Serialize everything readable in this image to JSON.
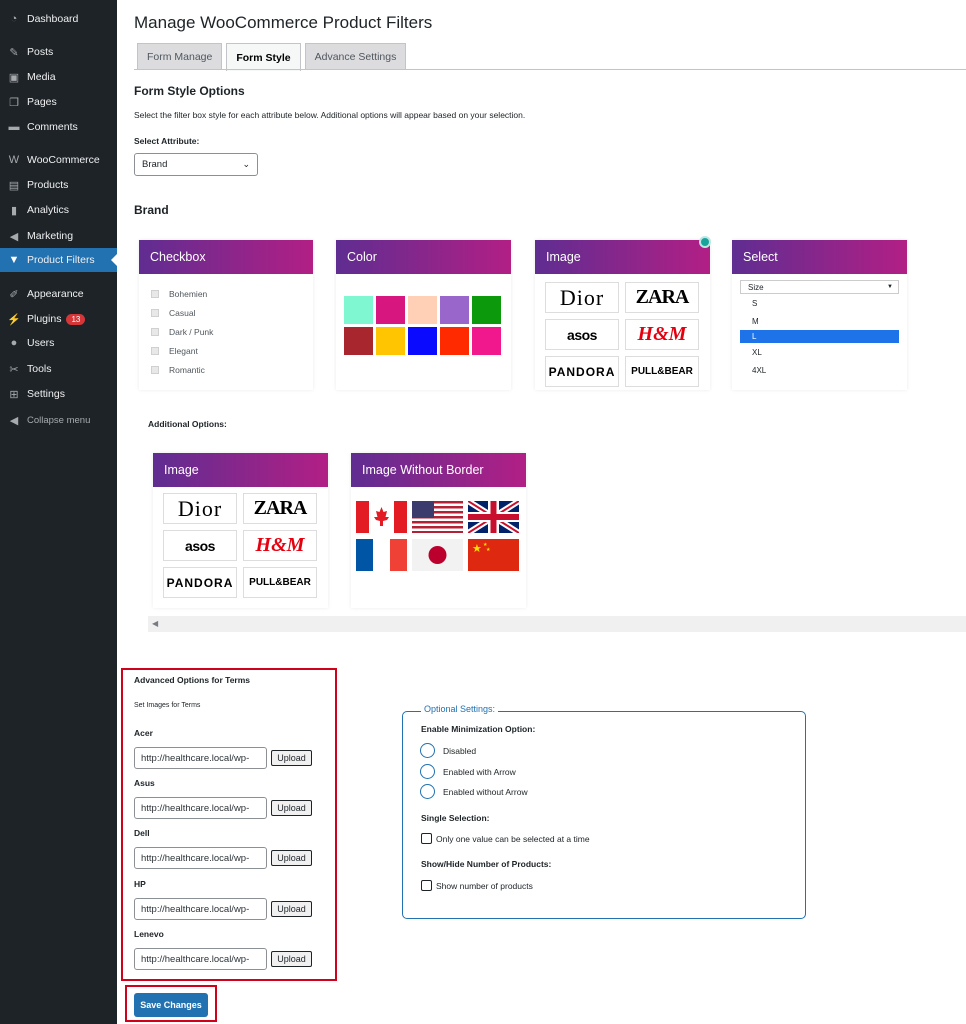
{
  "sidebar": {
    "items": [
      {
        "label": "Dashboard",
        "icon": "dashboard-icon",
        "glyph": "◔"
      },
      {
        "label": "Posts",
        "icon": "pin-icon",
        "glyph": "✎"
      },
      {
        "label": "Media",
        "icon": "media-icon",
        "glyph": "▣"
      },
      {
        "label": "Pages",
        "icon": "pages-icon",
        "glyph": "❐"
      },
      {
        "label": "Comments",
        "icon": "comment-icon",
        "glyph": "▬"
      },
      {
        "label": "WooCommerce",
        "icon": "woo-icon",
        "glyph": "W"
      },
      {
        "label": "Products",
        "icon": "products-icon",
        "glyph": "▤"
      },
      {
        "label": "Analytics",
        "icon": "analytics-icon",
        "glyph": "▮"
      },
      {
        "label": "Marketing",
        "icon": "megaphone-icon",
        "glyph": "◀"
      },
      {
        "label": "Product Filters",
        "icon": "filter-icon",
        "glyph": "▼"
      },
      {
        "label": "Appearance",
        "icon": "brush-icon",
        "glyph": "✐"
      },
      {
        "label": "Plugins",
        "icon": "plugin-icon",
        "glyph": "⚡",
        "badge": "13"
      },
      {
        "label": "Users",
        "icon": "user-icon",
        "glyph": "●"
      },
      {
        "label": "Tools",
        "icon": "wrench-icon",
        "glyph": "✂"
      },
      {
        "label": "Settings",
        "icon": "settings-icon",
        "glyph": "⊞"
      },
      {
        "label": "Collapse menu",
        "icon": "collapse-icon",
        "glyph": "◀"
      }
    ]
  },
  "page": {
    "title": "Manage WooCommerce Product Filters",
    "tabs": [
      "Form Manage",
      "Form Style",
      "Advance Settings"
    ],
    "active_tab": "Form Style",
    "section_title": "Form Style Options",
    "description": "Select the filter box style for each attribute below. Additional options will appear based on your selection.",
    "select_label": "Select Attribute:",
    "select_value": "Brand",
    "brand_heading": "Brand",
    "additional_options": "Additional Options:"
  },
  "styles": {
    "checkbox": {
      "title": "Checkbox",
      "items": [
        "Bohemien",
        "Casual",
        "Dark / Punk",
        "Elegant",
        "Romantic"
      ]
    },
    "color": {
      "title": "Color",
      "swatches": [
        "#7ff7d0",
        "#d7177f",
        "#ffd0b6",
        "#9966cc",
        "#0c9a0c",
        "#a8262e",
        "#ffc500",
        "#0a0aff",
        "#ff2a00",
        "#f0188c"
      ]
    },
    "image": {
      "title": "Image",
      "logos": [
        "Dior",
        "ZARA",
        "asos",
        "H&M",
        "PANDORA",
        "PULL&BEAR"
      ]
    },
    "select": {
      "title": "Select",
      "placeholder": "Size",
      "options": [
        "S",
        "M",
        "L",
        "XL",
        "4XL"
      ],
      "selected": "L"
    },
    "image2": {
      "title": "Image",
      "logos": [
        "Dior",
        "ZARA",
        "asos",
        "H&M",
        "PANDORA",
        "PULL&BEAR"
      ]
    },
    "image_no_border": {
      "title": "Image Without Border",
      "flags": [
        "canada-flag-icon",
        "usa-flag-icon",
        "uk-flag-icon",
        "france-flag-icon",
        "japan-flag-icon",
        "china-flag-icon"
      ]
    }
  },
  "advanced": {
    "title": "Advanced Options for Terms",
    "subtitle": "Set Images for Terms",
    "upload_label": "Upload",
    "terms": [
      {
        "name": "Acer",
        "value": "http://healthcare.local/wp-"
      },
      {
        "name": "Asus",
        "value": "http://healthcare.local/wp-"
      },
      {
        "name": "Dell",
        "value": "http://healthcare.local/wp-"
      },
      {
        "name": "HP",
        "value": "http://healthcare.local/wp-"
      },
      {
        "name": "Lenevo",
        "value": "http://healthcare.local/wp-"
      }
    ]
  },
  "optional": {
    "legend": "Optional Settings:",
    "min_label": "Enable Minimization Option:",
    "radios": [
      "Disabled",
      "Enabled with Arrow",
      "Enabled without Arrow"
    ],
    "single_label": "Single Selection:",
    "single_checkbox": "Only one value can be selected at a time",
    "showhide_label": "Show/Hide Number of Products:",
    "showhide_checkbox": "Show number of products"
  },
  "save_label": "Save Changes"
}
